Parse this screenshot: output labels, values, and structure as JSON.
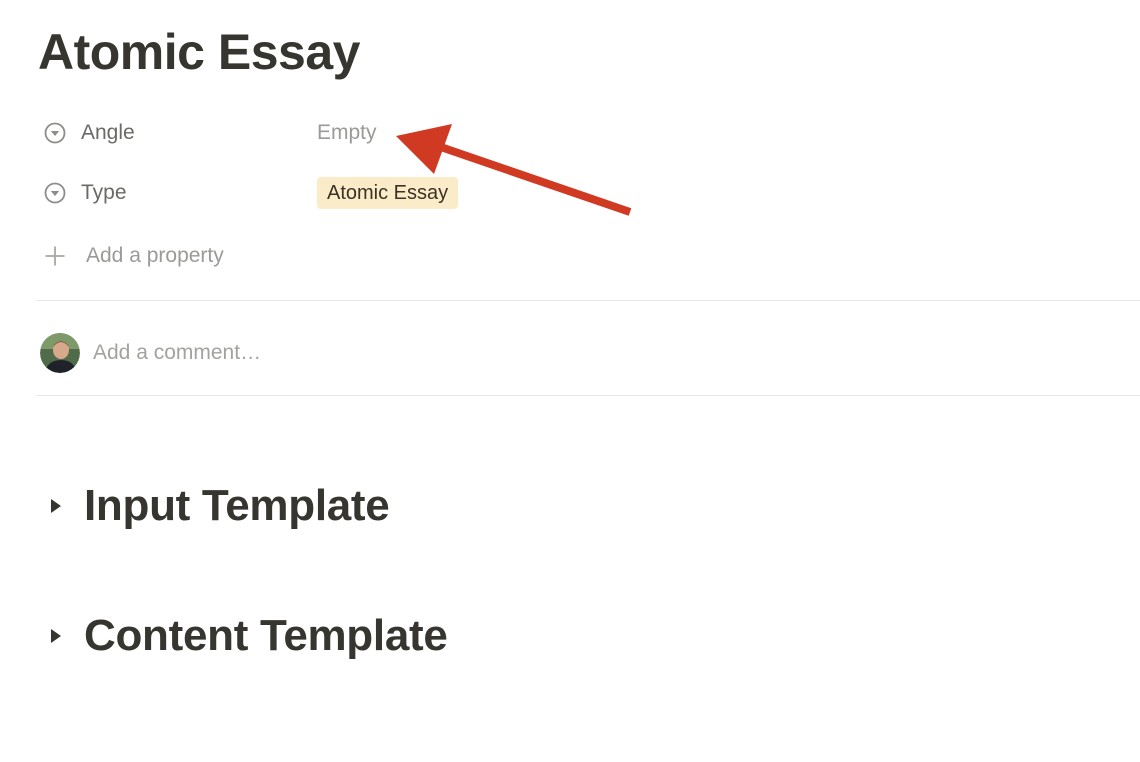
{
  "page": {
    "title": "Atomic Essay"
  },
  "properties": [
    {
      "name": "Angle",
      "icon": "select-property-icon",
      "value": "Empty"
    },
    {
      "name": "Type",
      "icon": "select-property-icon",
      "value": "Atomic Essay",
      "tag_color": "#fbecc9"
    }
  ],
  "add_property": {
    "icon": "plus-icon",
    "label": "Add a property"
  },
  "comments": {
    "placeholder": "Add a comment…"
  },
  "toggles": [
    {
      "label": "Input Template",
      "icon": "toggle-arrow-right-icon"
    },
    {
      "label": "Content Template",
      "icon": "toggle-arrow-right-icon"
    }
  ],
  "annotation": {
    "icon": "annotation-arrow-icon",
    "color": "#d03a22"
  }
}
